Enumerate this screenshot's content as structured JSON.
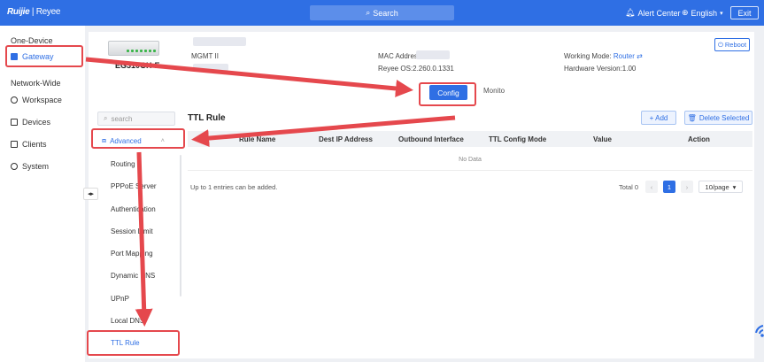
{
  "header": {
    "logo_brand": "Ruijie",
    "logo_sub": "Reyee",
    "search_label": "Search",
    "alert_center": "Alert Center",
    "language": "English",
    "exit_label": "Exit"
  },
  "nav": {
    "one_device_label": "One-Device",
    "gateway": "Gateway",
    "network_wide_label": "Network-Wide",
    "workspace": "Workspace",
    "devices": "Devices",
    "clients": "Clients",
    "system": "System"
  },
  "device": {
    "model": "EG310GH-E",
    "mgmt_label": "MGMT II",
    "mac_label": "MAC Address",
    "os_version": "Reyee OS:2.260.0.1331",
    "working_mode_label": "Working Mode:",
    "working_mode_value": "Router",
    "hardware_version": "Hardware Version:1.00",
    "reboot_label": "Reboot"
  },
  "tabs": {
    "monitor": "Monito",
    "config": "Config"
  },
  "submenu": {
    "search_placeholder": "search",
    "group_label": "Advanced",
    "items": [
      "Routing",
      "PPPoE Server",
      "Authentication",
      "Session Limit",
      "Port Mapping",
      "Dynamic DNS",
      "UPnP",
      "Local DNS",
      "TTL Rule"
    ]
  },
  "ttl": {
    "title": "TTL Rule",
    "add_label": "+ Add",
    "delete_label": "Delete Selected",
    "columns": [
      "Rule Name",
      "Dest IP Address",
      "Outbound Interface",
      "TTL Config Mode",
      "Value",
      "Action"
    ],
    "empty_text": "No Data",
    "footer_note": "Up to 1 entries can be added.",
    "total_label": "Total 0",
    "current_page": "1",
    "page_size": "10/page"
  },
  "colors": {
    "primary": "#2f6fe4",
    "annotation_red": "#e5484d"
  }
}
